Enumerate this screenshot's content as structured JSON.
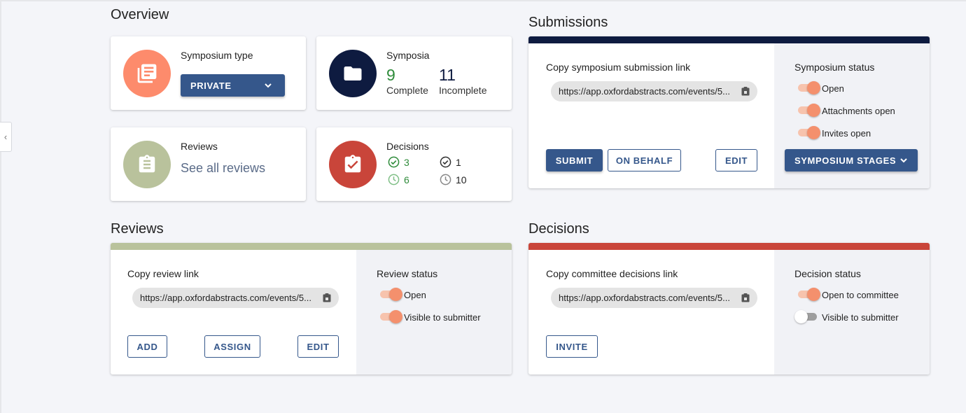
{
  "overview": {
    "title": "Overview",
    "symposium_type": {
      "label": "Symposium type",
      "value": "PRIVATE"
    },
    "symposia": {
      "label": "Symposia",
      "complete_count": "9",
      "complete_label": "Complete",
      "incomplete_count": "11",
      "incomplete_label": "Incomplete"
    },
    "reviews": {
      "label": "Reviews",
      "link": "See all reviews"
    },
    "decisions": {
      "label": "Decisions",
      "accepted": "3",
      "decided": "1",
      "pending_accept": "6",
      "pending": "10"
    }
  },
  "submissions": {
    "title": "Submissions",
    "copy_label": "Copy symposium submission link",
    "link": "https://app.oxfordabstracts.com/events/5...",
    "buttons": {
      "submit": "SUBMIT",
      "on_behalf": "ON BEHALF",
      "edit": "EDIT",
      "stages": "SYMPOSIUM STAGES"
    },
    "status_title": "Symposium status",
    "toggles": [
      {
        "label": "Open",
        "on": true
      },
      {
        "label": "Attachments open",
        "on": true
      },
      {
        "label": "Invites open",
        "on": true
      }
    ]
  },
  "reviews": {
    "title": "Reviews",
    "copy_label": "Copy review link",
    "link": "https://app.oxfordabstracts.com/events/5...",
    "buttons": {
      "add": "ADD",
      "assign": "ASSIGN",
      "edit": "EDIT"
    },
    "status_title": "Review status",
    "toggles": [
      {
        "label": "Open",
        "on": true
      },
      {
        "label": "Visible to submitter",
        "on": true
      }
    ]
  },
  "decisions": {
    "title": "Decisions",
    "copy_label": "Copy committee decisions link",
    "link": "https://app.oxfordabstracts.com/events/5...",
    "buttons": {
      "invite": "INVITE"
    },
    "status_title": "Decision status",
    "toggles": [
      {
        "label": "Open to committee",
        "on": true
      },
      {
        "label": "Visible to submitter",
        "on": false
      }
    ]
  },
  "colors": {
    "primary": "#35578b",
    "navy": "#0e1b40",
    "orange": "#fd8b6c",
    "sage": "#b9c29c",
    "red": "#c9453a",
    "green": "#2e8b3a",
    "toggle_on": "#f4906d"
  },
  "icons": [
    "chevron-left-icon",
    "library-books-icon",
    "folder-icon",
    "clipboard-icon",
    "assignment-check-icon",
    "check-circle-icon",
    "clock-icon",
    "clipboard-copy-icon",
    "chevron-down-icon"
  ]
}
